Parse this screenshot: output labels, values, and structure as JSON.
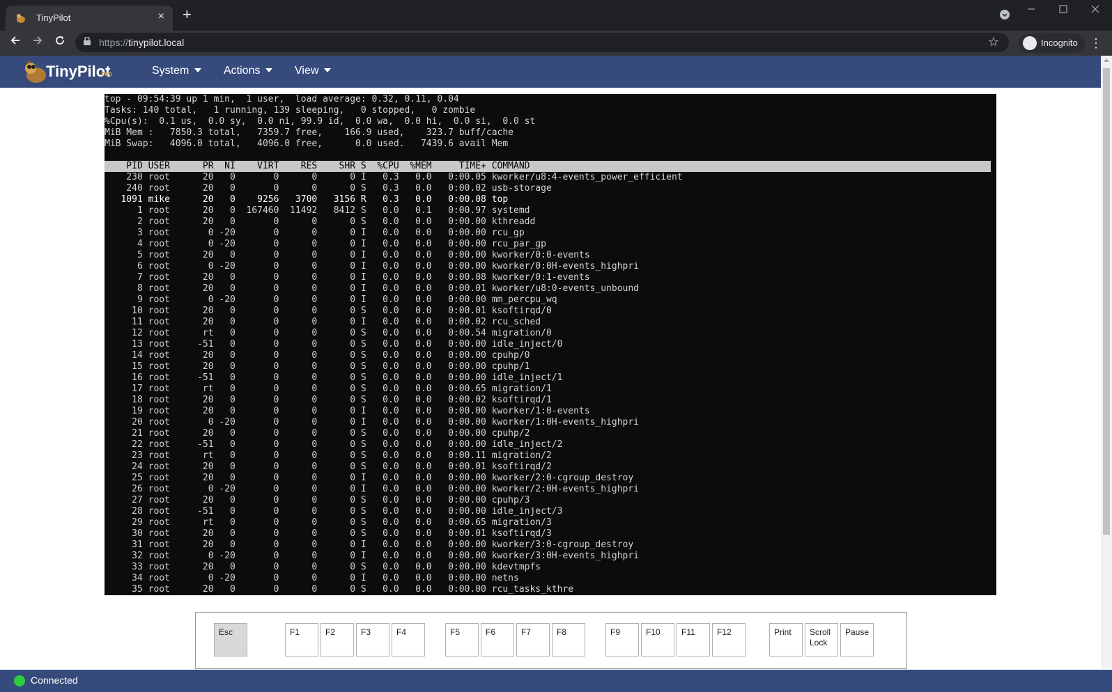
{
  "browser": {
    "tab_title": "TinyPilot",
    "new_tab": "+",
    "close_tab": "×",
    "url_scheme": "https://",
    "url_host": "tinypilot.local",
    "profile_label": "Incognito"
  },
  "app": {
    "brand": "TinyPilot",
    "brand_suffix": "PRO",
    "menus": [
      "System",
      "Actions",
      "View"
    ]
  },
  "terminal": {
    "summary": [
      "top - 09:54:39 up 1 min,  1 user,  load average: 0.32, 0.11, 0.04",
      "Tasks: 140 total,   1 running, 139 sleeping,   0 stopped,   0 zombie",
      "%Cpu(s):  0.1 us,  0.0 sy,  0.0 ni, 99.9 id,  0.0 wa,  0.0 hi,  0.0 si,  0.0 st",
      "MiB Mem :   7850.3 total,   7359.7 free,    166.9 used,    323.7 buff/cache",
      "MiB Swap:   4096.0 total,   4096.0 free,      0.0 used.   7439.6 avail Mem"
    ],
    "header": "    PID USER      PR  NI    VIRT    RES    SHR S  %CPU  %MEM     TIME+ COMMAND",
    "rows": [
      "    230 root      20   0       0      0      0 I   0.3   0.0   0:00.05 kworker/u8:4-events_power_efficient",
      "    240 root      20   0       0      0      0 S   0.3   0.0   0:00.02 usb-storage",
      "   1091 mike      20   0    9256   3700   3156 R   0.3   0.0   0:00.08 top",
      "      1 root      20   0  167460  11492   8412 S   0.0   0.1   0:00.97 systemd",
      "      2 root      20   0       0      0      0 S   0.0   0.0   0:00.00 kthreadd",
      "      3 root       0 -20       0      0      0 I   0.0   0.0   0:00.00 rcu_gp",
      "      4 root       0 -20       0      0      0 I   0.0   0.0   0:00.00 rcu_par_gp",
      "      5 root      20   0       0      0      0 I   0.0   0.0   0:00.00 kworker/0:0-events",
      "      6 root       0 -20       0      0      0 I   0.0   0.0   0:00.00 kworker/0:0H-events_highpri",
      "      7 root      20   0       0      0      0 I   0.0   0.0   0:00.08 kworker/0:1-events",
      "      8 root      20   0       0      0      0 I   0.0   0.0   0:00.01 kworker/u8:0-events_unbound",
      "      9 root       0 -20       0      0      0 I   0.0   0.0   0:00.00 mm_percpu_wq",
      "     10 root      20   0       0      0      0 S   0.0   0.0   0:00.01 ksoftirqd/0",
      "     11 root      20   0       0      0      0 I   0.0   0.0   0:00.02 rcu_sched",
      "     12 root      rt   0       0      0      0 S   0.0   0.0   0:00.54 migration/0",
      "     13 root     -51   0       0      0      0 S   0.0   0.0   0:00.00 idle_inject/0",
      "     14 root      20   0       0      0      0 S   0.0   0.0   0:00.00 cpuhp/0",
      "     15 root      20   0       0      0      0 S   0.0   0.0   0:00.00 cpuhp/1",
      "     16 root     -51   0       0      0      0 S   0.0   0.0   0:00.00 idle_inject/1",
      "     17 root      rt   0       0      0      0 S   0.0   0.0   0:00.65 migration/1",
      "     18 root      20   0       0      0      0 S   0.0   0.0   0:00.02 ksoftirqd/1",
      "     19 root      20   0       0      0      0 I   0.0   0.0   0:00.00 kworker/1:0-events",
      "     20 root       0 -20       0      0      0 I   0.0   0.0   0:00.00 kworker/1:0H-events_highpri",
      "     21 root      20   0       0      0      0 S   0.0   0.0   0:00.00 cpuhp/2",
      "     22 root     -51   0       0      0      0 S   0.0   0.0   0:00.00 idle_inject/2",
      "     23 root      rt   0       0      0      0 S   0.0   0.0   0:00.11 migration/2",
      "     24 root      20   0       0      0      0 S   0.0   0.0   0:00.01 ksoftirqd/2",
      "     25 root      20   0       0      0      0 I   0.0   0.0   0:00.00 kworker/2:0-cgroup_destroy",
      "     26 root       0 -20       0      0      0 I   0.0   0.0   0:00.00 kworker/2:0H-events_highpri",
      "     27 root      20   0       0      0      0 S   0.0   0.0   0:00.00 cpuhp/3",
      "     28 root     -51   0       0      0      0 S   0.0   0.0   0:00.00 idle_inject/3",
      "     29 root      rt   0       0      0      0 S   0.0   0.0   0:00.65 migration/3",
      "     30 root      20   0       0      0      0 S   0.0   0.0   0:00.01 ksoftirqd/3",
      "     31 root      20   0       0      0      0 I   0.0   0.0   0:00.00 kworker/3:0-cgroup_destroy",
      "     32 root       0 -20       0      0      0 I   0.0   0.0   0:00.00 kworker/3:0H-events_highpri",
      "     33 root      20   0       0      0      0 S   0.0   0.0   0:00.00 kdevtmpfs",
      "     34 root       0 -20       0      0      0 I   0.0   0.0   0:00.00 netns",
      "     35 root      20   0       0      0      0 S   0.0   0.0   0:00.00 rcu_tasks_kthre"
    ]
  },
  "keyboard": {
    "keys": [
      "Esc",
      "F1",
      "F2",
      "F3",
      "F4",
      "F5",
      "F6",
      "F7",
      "F8",
      "F9",
      "F10",
      "F11",
      "F12",
      "Print",
      "Scroll Lock",
      "Pause"
    ]
  },
  "status": {
    "text": "Connected",
    "color": "#2ecc40"
  },
  "colors": {
    "accent": "#364b7c"
  }
}
